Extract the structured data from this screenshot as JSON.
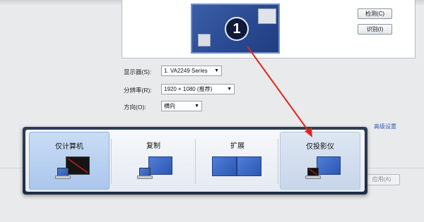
{
  "monitor": {
    "number": "1"
  },
  "buttons": {
    "detect": "检测(C)",
    "identify": "识别(I)",
    "apply": "应用(A)"
  },
  "settings": {
    "display_label": "显示器(S):",
    "display_value": "1. VA2249 Series",
    "resolution_label": "分辨率(R):",
    "resolution_value": "1920 × 1080 (推荐)",
    "orientation_label": "方向(O):",
    "orientation_value": "横向"
  },
  "advanced_link": "高级设置",
  "projection_options": [
    {
      "label": "仅计算机",
      "selected": true
    },
    {
      "label": "复制",
      "selected": false
    },
    {
      "label": "扩展",
      "selected": false
    },
    {
      "label": "仅投影仪",
      "selected": false
    }
  ],
  "colors": {
    "accent": "#2a5db0",
    "arrow": "#e0261c",
    "monitor_blue": "#2a4a92"
  }
}
